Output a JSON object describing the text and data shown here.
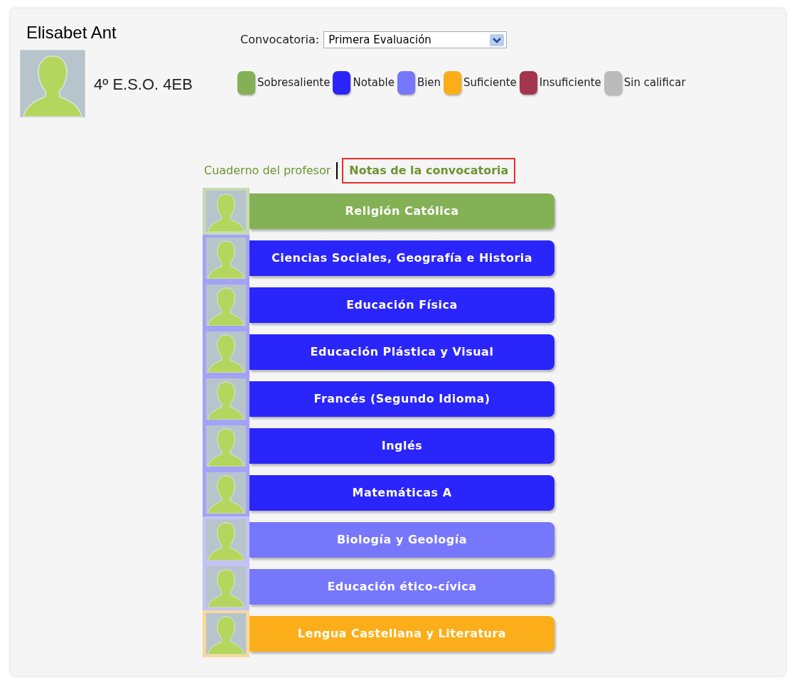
{
  "student": {
    "name": "Elisabet Ant",
    "group": "4º E.S.O. 4EB"
  },
  "convocatoria": {
    "label": "Convocatoria:",
    "value": "Primera Evaluación"
  },
  "legend": [
    {
      "label": "Sobresaliente",
      "color": "#84b155"
    },
    {
      "label": "Notable",
      "color": "#2a25fb"
    },
    {
      "label": "Bien",
      "color": "#7777fc"
    },
    {
      "label": "Suficiente",
      "color": "#fcae1a"
    },
    {
      "label": "Insuficiente",
      "color": "#a3354d"
    },
    {
      "label": "Sin calificar",
      "color": "#bbbbbb"
    }
  ],
  "tabs": [
    {
      "label": "Cuaderno del profesor",
      "selected": false
    },
    {
      "label": "Notas de la convocatoria",
      "selected": true
    }
  ],
  "subjects": [
    {
      "name": "Religión Católica",
      "color": "#84b155"
    },
    {
      "name": "Ciencias Sociales, Geografía e Historia",
      "color": "#2a25fb"
    },
    {
      "name": "Educación Física",
      "color": "#2a25fb"
    },
    {
      "name": "Educación Plástica y Visual",
      "color": "#2a25fb"
    },
    {
      "name": "Francés (Segundo Idioma)",
      "color": "#2a25fb"
    },
    {
      "name": "Inglés",
      "color": "#2a25fb"
    },
    {
      "name": "Matemáticas A",
      "color": "#2a25fb"
    },
    {
      "name": "Biología y Geología",
      "color": "#7777fc"
    },
    {
      "name": "Educación ético-cívica",
      "color": "#7777fc"
    },
    {
      "name": "Lengua Castellana y Literatura",
      "color": "#fcae1a"
    }
  ]
}
